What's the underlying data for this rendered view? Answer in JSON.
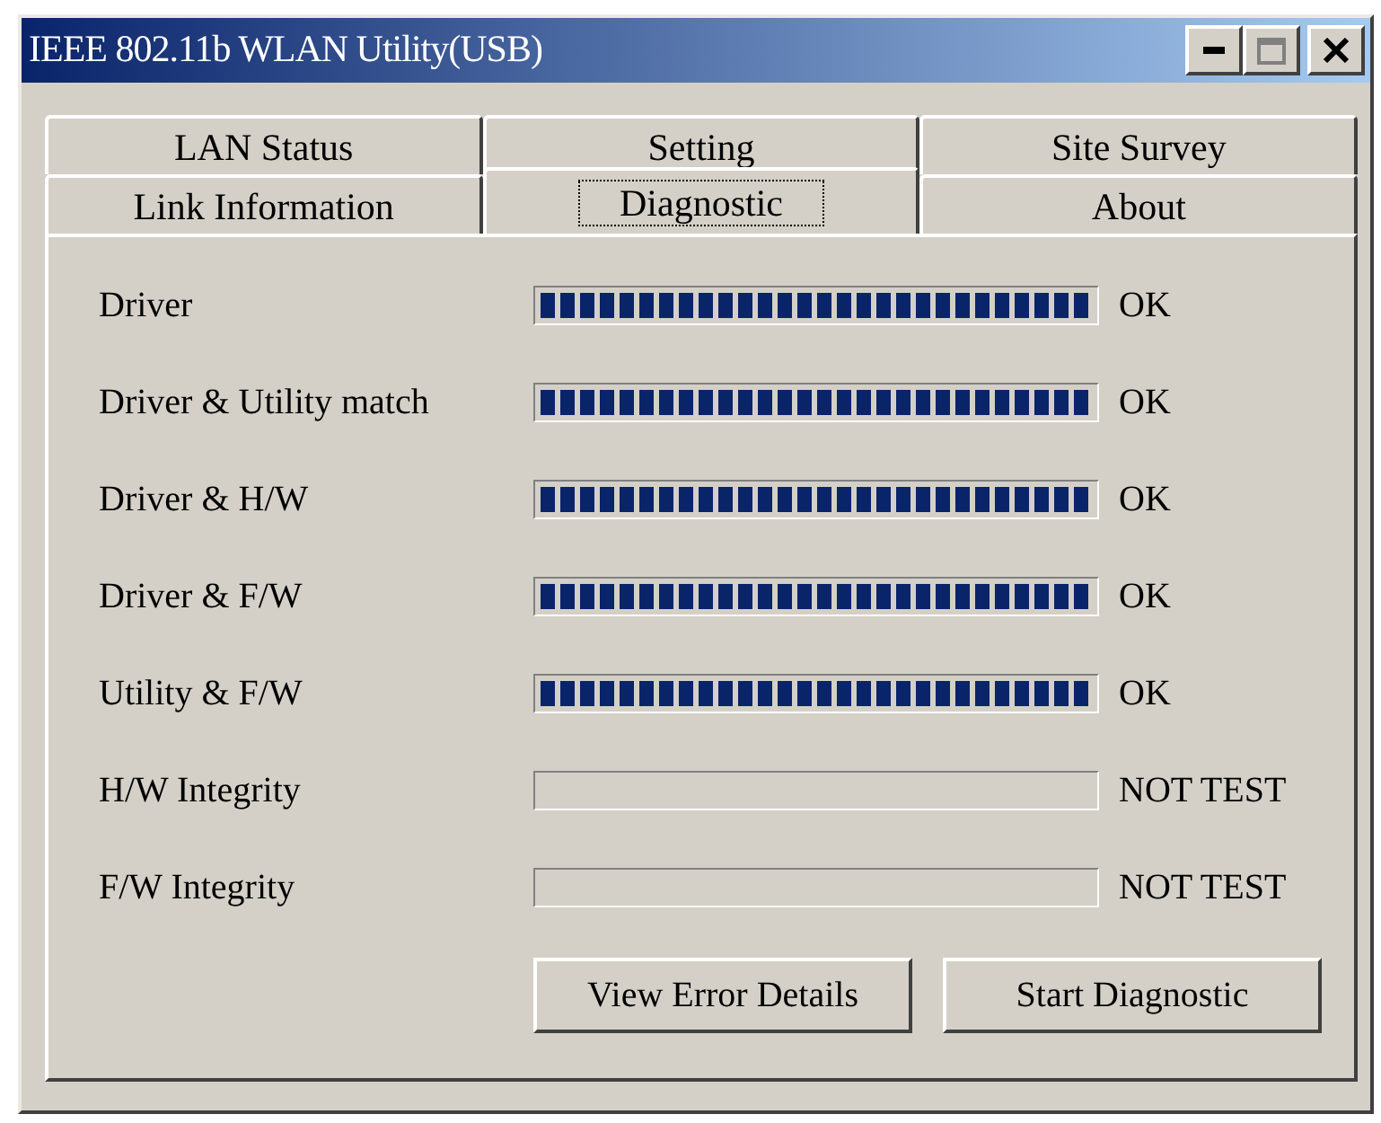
{
  "window": {
    "title": "IEEE 802.11b WLAN Utility(USB)"
  },
  "tab_rows": [
    {
      "tabs": [
        {
          "label": "LAN Status",
          "selected": false
        },
        {
          "label": "Setting",
          "selected": false
        },
        {
          "label": "Site Survey",
          "selected": false
        }
      ]
    },
    {
      "tabs": [
        {
          "label": "Link Information",
          "selected": false
        },
        {
          "label": "Diagnostic",
          "selected": true
        },
        {
          "label": "About",
          "selected": false
        }
      ]
    }
  ],
  "tests": [
    {
      "name": "Driver",
      "level": 1,
      "result": "OK"
    },
    {
      "name": "Driver & Utility match",
      "level": 1,
      "result": "OK"
    },
    {
      "name": "Driver & H/W",
      "level": 1,
      "result": "OK"
    },
    {
      "name": "Driver & F/W",
      "level": 1,
      "result": "OK"
    },
    {
      "name": "Utility & F/W",
      "level": 1,
      "result": "OK"
    },
    {
      "name": "H/W Integrity",
      "level": 0,
      "result": "NOT TEST"
    },
    {
      "name": "F/W Integrity",
      "level": 0,
      "result": "NOT TEST"
    }
  ],
  "buttons": [
    "View Error Details",
    "Start Diagnostic"
  ]
}
